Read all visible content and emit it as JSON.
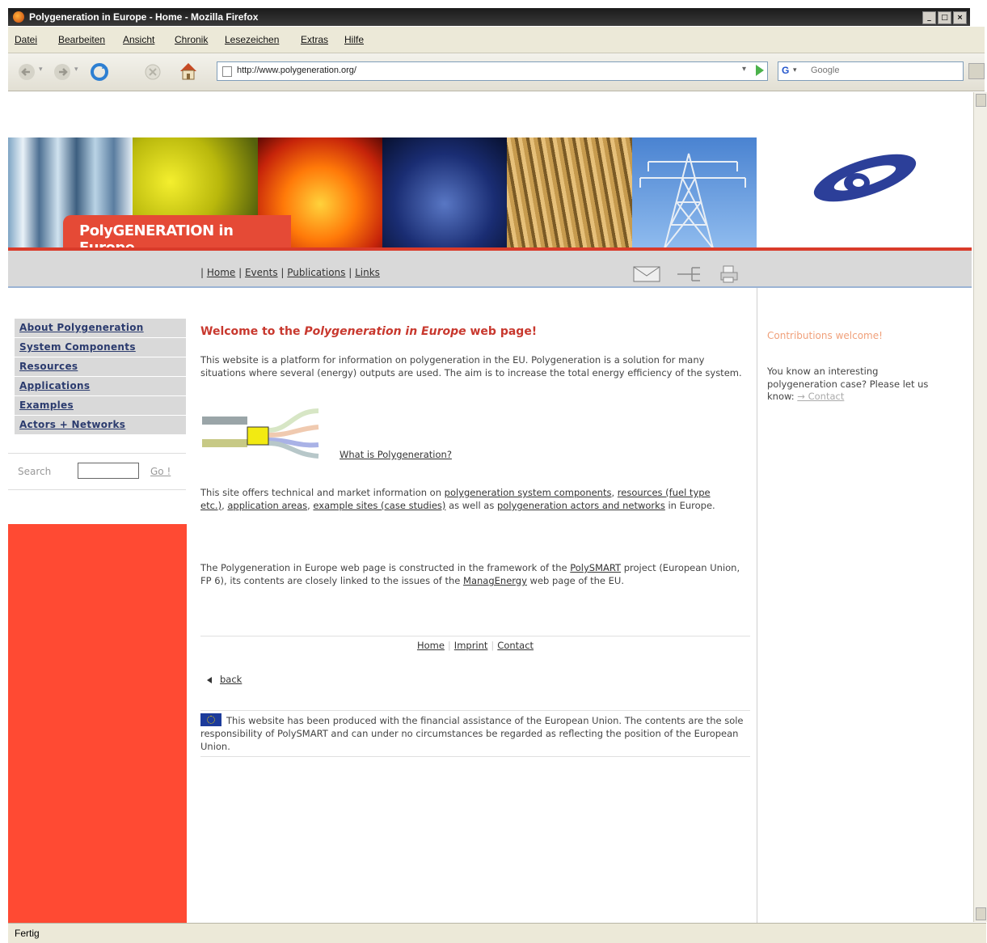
{
  "window": {
    "title": "Polygeneration in Europe - Home - Mozilla Firefox",
    "controls": [
      "_",
      "□",
      "×"
    ]
  },
  "menu": [
    "Datei",
    "Bearbeiten",
    "Ansicht",
    "Chronik",
    "Lesezeichen",
    "Extras",
    "Hilfe"
  ],
  "toolbar": {
    "url": "http://www.polygeneration.org/",
    "search_placeholder": "Google",
    "search_engine": "G"
  },
  "status": "Fertig",
  "banner": {
    "label": "PolyGENERATION in Europe"
  },
  "topnav": {
    "items": [
      "Home",
      "Events",
      "Publications",
      "Links"
    ]
  },
  "leftnav": {
    "items": [
      "About Polygeneration",
      "System Components",
      "Resources",
      "Applications",
      "Examples",
      "Actors + Networks"
    ],
    "search_label": "Search",
    "go_label": "Go !"
  },
  "main": {
    "welcome_pre": "Welcome to the ",
    "welcome_italic": "Polygeneration in Europe",
    "welcome_post": " web page!",
    "intro": "This website is a platform for information on polygeneration in the EU. Polygeneration is a solution for many situations where several (energy) outputs are used. The aim is to increase the total energy efficiency of the system.",
    "what_is_link": "What is Polygeneration?",
    "offers": {
      "t1": "This site offers technical and market information on ",
      "l1": "polygeneration system components",
      "t2": ", ",
      "l2": "resources (fuel type etc.)",
      "t3": ", ",
      "l3": "application areas",
      "t4": ", ",
      "l4": "example sites (case studies)",
      "t5": " as well as ",
      "l5": "polygeneration actors and networks",
      "t6": " in Europe."
    },
    "framework": {
      "t1": "The Polygeneration in Europe web page is constructed in the framework of the ",
      "l1": "PolySMART",
      "t2": " project (European Union, FP 6), its contents are closely linked to the issues of the ",
      "l2": "ManagEnergy",
      "t3": " web page of the EU."
    },
    "footer_links": [
      "Home",
      "Imprint",
      "Contact"
    ],
    "back_label": "back",
    "disclaimer": "This website has been produced with the financial assistance of the European Union. The contents are the sole responsibility of PolySMART and can under no circumstances be regarded as reflecting the position of the European Union."
  },
  "right": {
    "heading": "Contributions welcome!",
    "text": "You know an interesting polygeneration case? Please let us know: ",
    "contact_link": "→ Contact"
  },
  "colors": {
    "accent_red": "#ff4a33",
    "heading_red": "#c8382e",
    "nav_blue": "#2b3b6e",
    "grey_bar": "#d9d9d9"
  },
  "icons": {
    "back": "back-arrow-icon",
    "forward": "forward-arrow-icon",
    "reload": "reload-icon",
    "stop": "stop-icon",
    "home": "home-icon",
    "mail": "mail-icon",
    "sitemap": "sitemap-icon",
    "print": "print-icon"
  }
}
